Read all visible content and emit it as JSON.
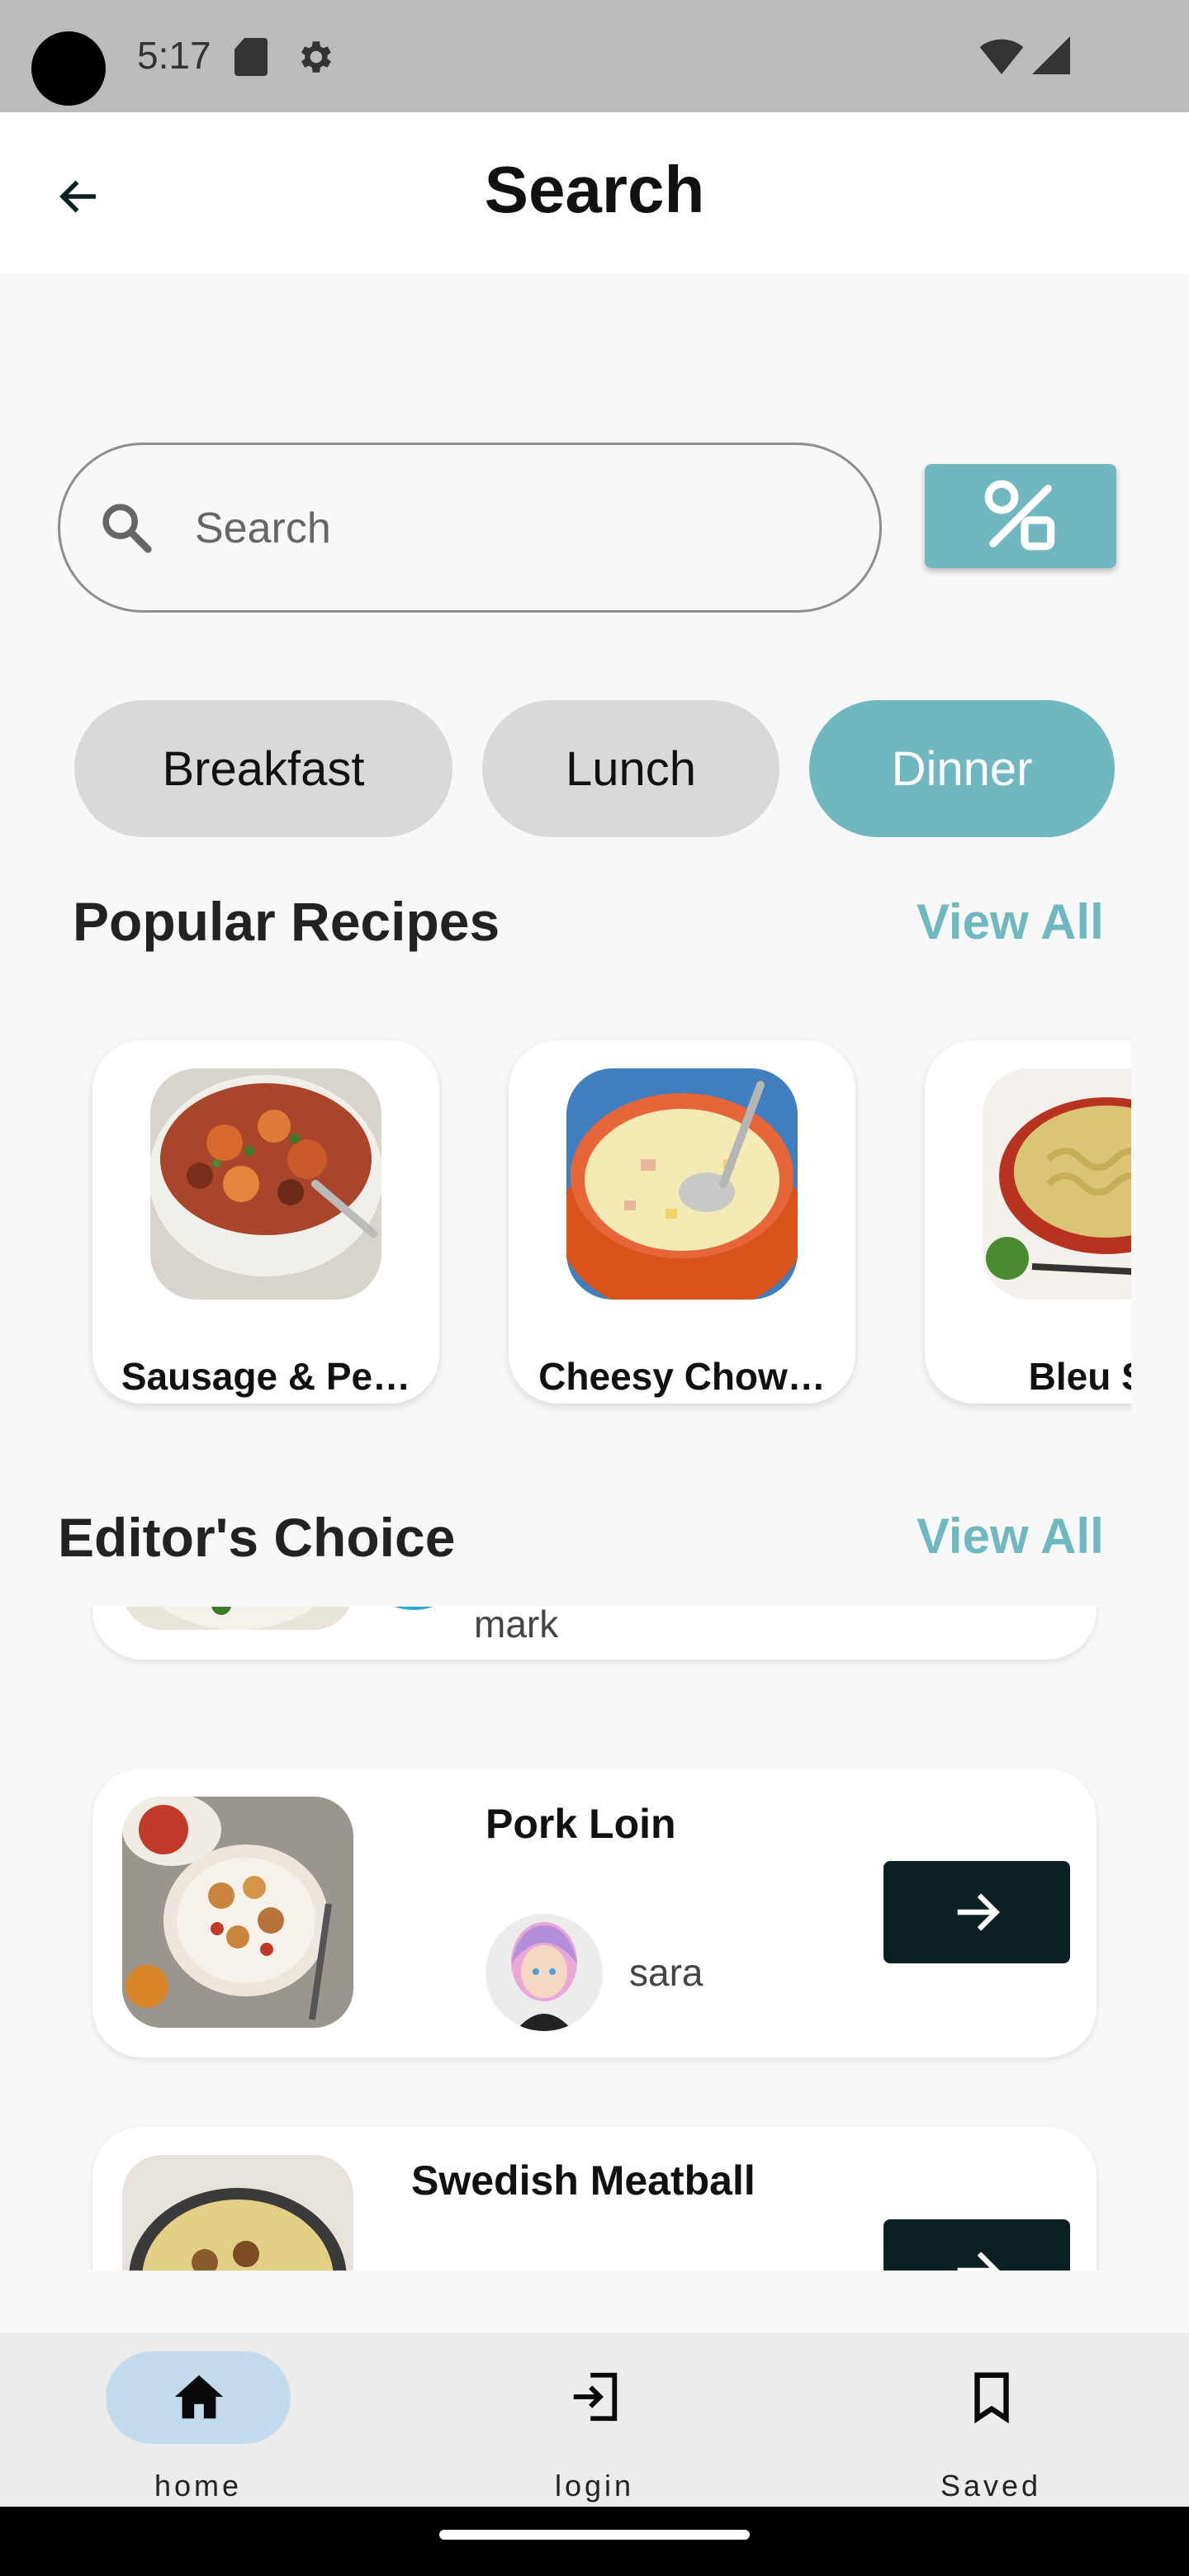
{
  "status_bar": {
    "time": "5:17"
  },
  "app_bar": {
    "title": "Search"
  },
  "search": {
    "placeholder": "Search",
    "value": ""
  },
  "categories": [
    {
      "label": "Breakfast",
      "selected": false
    },
    {
      "label": "Lunch",
      "selected": false
    },
    {
      "label": "Dinner",
      "selected": true
    }
  ],
  "popular": {
    "title": "Popular Recipes",
    "view_all": "View All",
    "items": [
      {
        "name": "Sausage & Pe…"
      },
      {
        "name": "Cheesy Chow…"
      },
      {
        "name": "Bleu Sk"
      }
    ]
  },
  "editors_choice": {
    "title": "Editor's Choice",
    "view_all": "View All",
    "items": [
      {
        "name": "",
        "author": "mark"
      },
      {
        "name": "Pork Loin",
        "author": "sara"
      },
      {
        "name": "Swedish Meatball",
        "author": ""
      }
    ]
  },
  "bottom_nav": {
    "items": [
      {
        "label": "home",
        "icon": "home-icon",
        "active": true
      },
      {
        "label": "login",
        "icon": "login-icon",
        "active": false
      },
      {
        "label": "Saved",
        "icon": "bookmark-icon",
        "active": false
      }
    ]
  },
  "colors": {
    "accent": "#6fb8bf",
    "dark_button": "#0a2023",
    "nav_active_pill": "#c2dcee",
    "chip_inactive": "#d9d9d9"
  }
}
